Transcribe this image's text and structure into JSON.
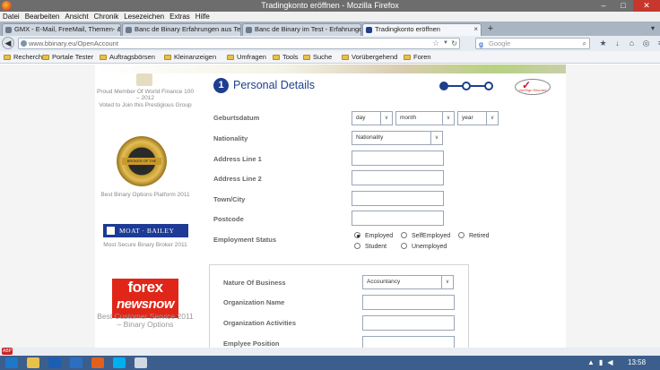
{
  "window": {
    "title": "Tradingkonto eröffnen - Mozilla Firefox"
  },
  "menu": [
    "Datei",
    "Bearbeiten",
    "Ansicht",
    "Chronik",
    "Lesezeichen",
    "Extras",
    "Hilfe"
  ],
  "tabs": [
    {
      "label": "GMX - E-Mail, FreeMail, Themen- & ..."
    },
    {
      "label": "Banc de Binary Erfahrungen aus Test ..."
    },
    {
      "label": "Banc de Binary im Test - Erfahrungen..."
    },
    {
      "label": "Tradingkonto eröffnen"
    }
  ],
  "nav": {
    "url": "www.bbinary.eu/OpenAccount",
    "search_placeholder": "Google"
  },
  "bookmarks": [
    "Recherche",
    "Portale Tester",
    "Auftragsbörsen",
    "Kleinanzeigen",
    "Umfragen",
    "Tools",
    "Suche",
    "Vorübergehend",
    "Foren"
  ],
  "sidebar": {
    "award1_caption": "Proud Member Of World Finance 100 – 2012",
    "award1_sub": "Voted to Join this Prestigious Group",
    "award2_ribbon": "BROKER OF THE YEAR",
    "award2_caption": "Best Binary Options Platform 2011",
    "award3_logo": "MOAT · BAILEY",
    "award3_caption": "Most Secure Binary Broker 2011",
    "forex_line1": "forex",
    "forex_line2": "newsnow",
    "forex_caption": "Best Customer Service 2011 – Binary Options"
  },
  "form": {
    "step_number": "1",
    "title": "Personal Details",
    "verisign": "VeriSign Secured",
    "dob_label": "Geburtsdatum",
    "dob_day": "day",
    "dob_month": "month",
    "dob_year": "year",
    "nationality_label": "Nationality",
    "nationality_value": "Nationality",
    "address1_label": "Address Line 1",
    "address2_label": "Address Line 2",
    "town_label": "Town/City",
    "postcode_label": "Postcode",
    "employment_label": "Employment Status",
    "employment_options": [
      "Employed",
      "SelfEmployed",
      "Retired",
      "Student",
      "Unemployed"
    ],
    "employment_selected": "Employed",
    "business_label": "Nature Of Business",
    "business_value": "Accountancy",
    "org_name_label": "Organization Name",
    "org_activities_label": "Organization Activities",
    "position_label": "Emplyee Position"
  },
  "taskbar": {
    "time": "13:58"
  },
  "colors": {
    "accent": "#1e3f8f",
    "forex_red": "#e02618",
    "moat_blue": "#1d3a94"
  }
}
